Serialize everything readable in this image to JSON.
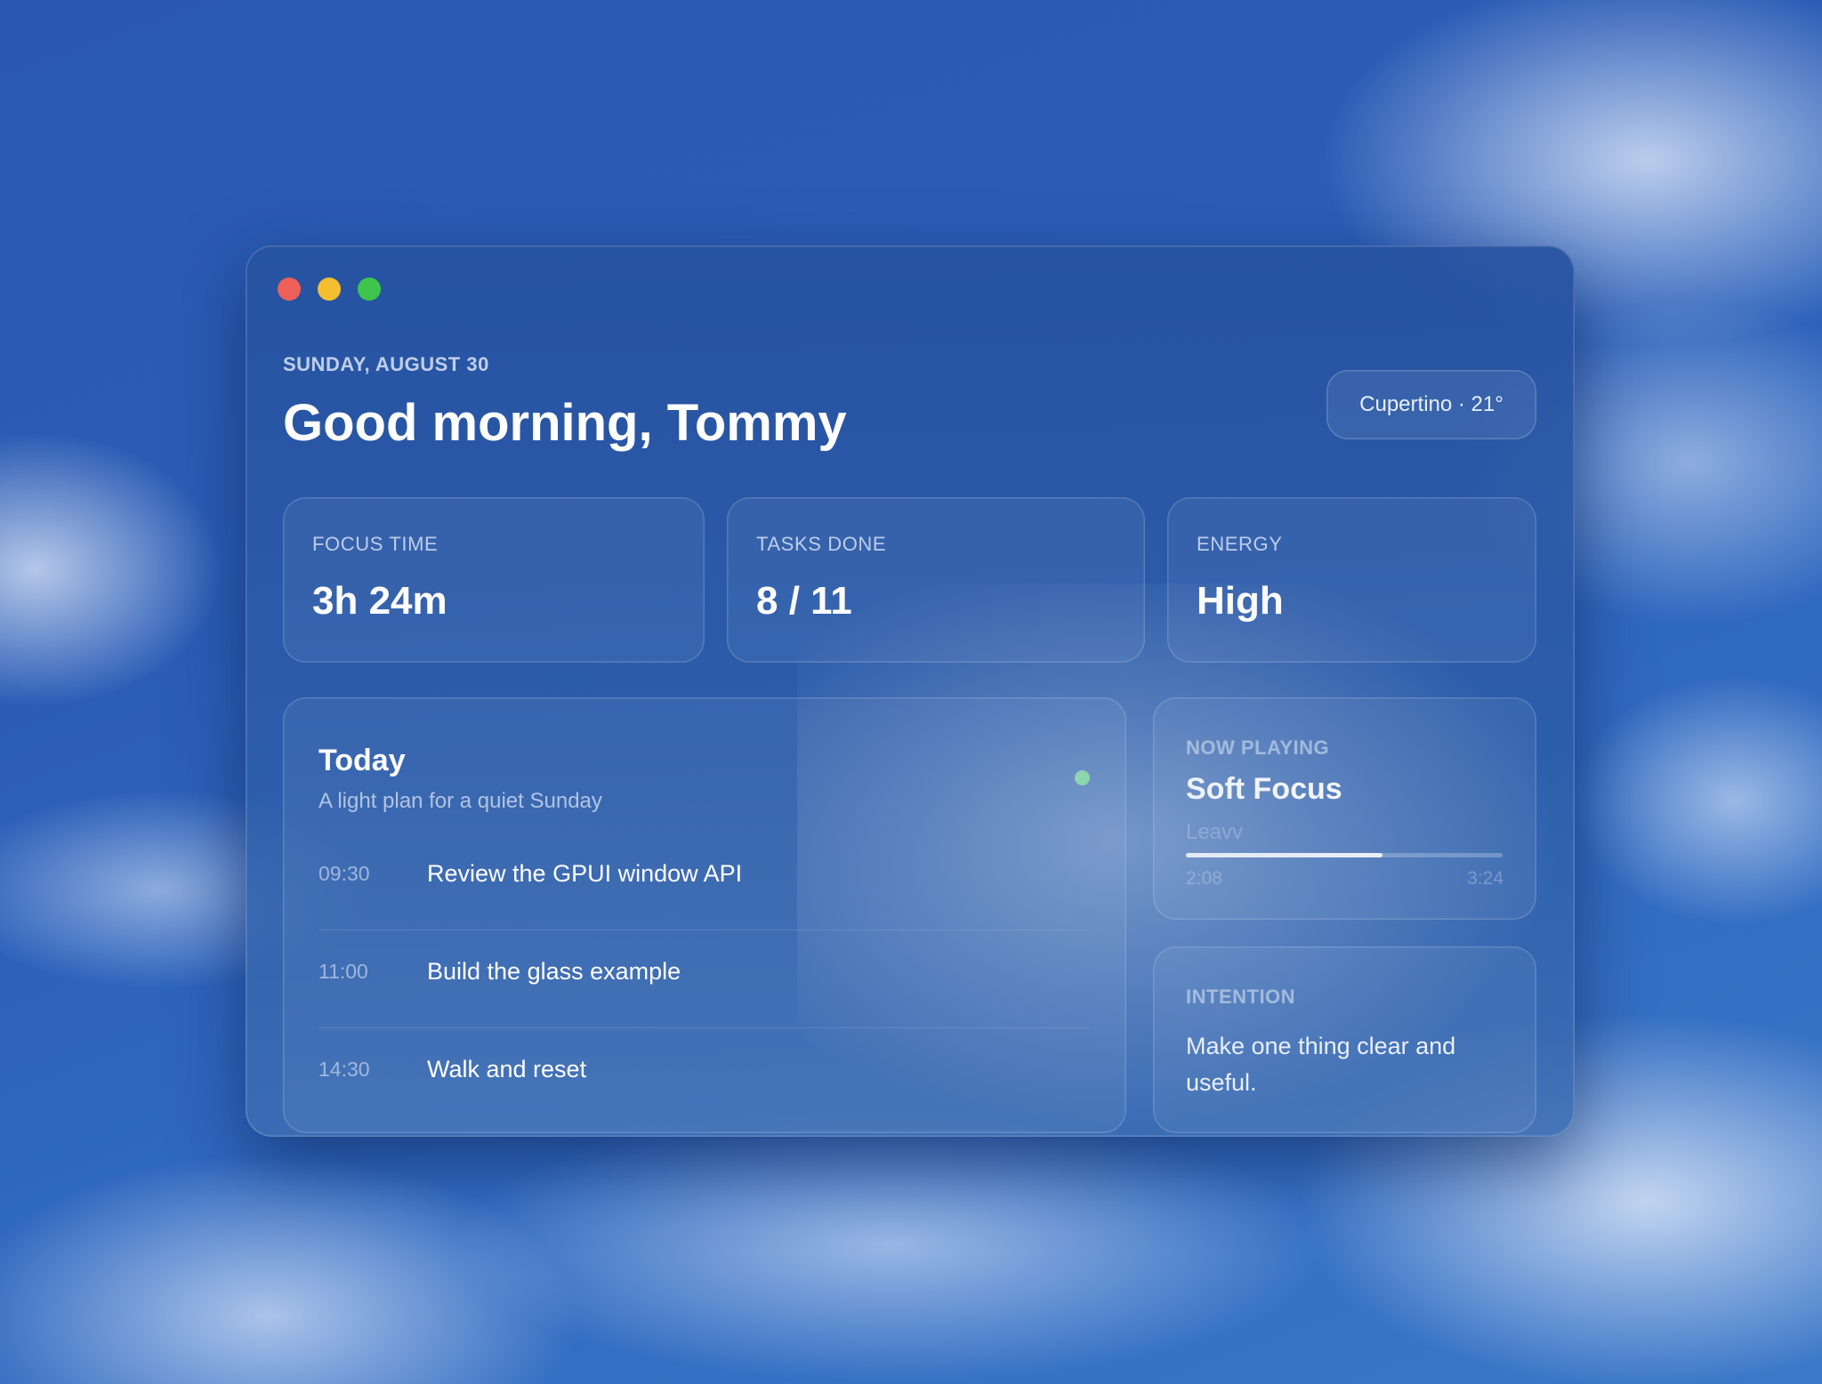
{
  "header": {
    "date": "SUNDAY, AUGUST 30",
    "greeting": "Good morning, Tommy",
    "location_weather": "Cupertino · 21°"
  },
  "stats": [
    {
      "label": "FOCUS TIME",
      "value": "3h 24m"
    },
    {
      "label": "TASKS DONE",
      "value": "8 / 11"
    },
    {
      "label": "ENERGY",
      "value": "High"
    }
  ],
  "today": {
    "title": "Today",
    "subtitle": "A light plan for a quiet Sunday",
    "status_color": "#6fd68e",
    "items": [
      {
        "time": "09:30",
        "task": "Review the GPUI window API"
      },
      {
        "time": "11:00",
        "task": "Build the glass example"
      },
      {
        "time": "14:30",
        "task": "Walk and reset"
      }
    ]
  },
  "now_playing": {
    "label": "NOW PLAYING",
    "title": "Soft Focus",
    "artist": "Leavv",
    "elapsed": "2:08",
    "total": "3:24",
    "progress": 0.62
  },
  "intention": {
    "label": "INTENTION",
    "text": "Make one thing clear and useful."
  },
  "window_controls": {
    "close_color": "#ee5f57",
    "minimize_color": "#f3be2f",
    "zoom_color": "#3fc54b"
  }
}
